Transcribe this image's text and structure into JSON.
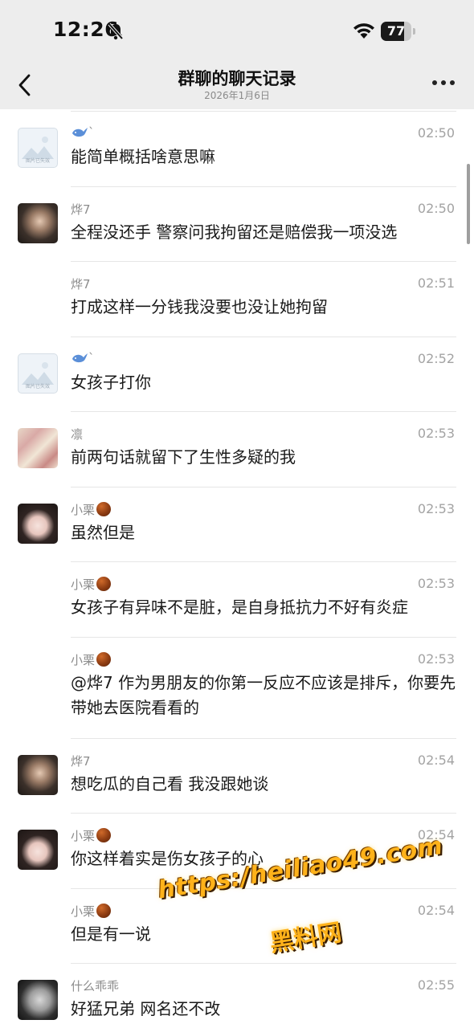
{
  "status": {
    "time": "12:26",
    "battery": "77",
    "battery_level": 0.77
  },
  "nav": {
    "title": "群聊的聊天记录",
    "subtitle": "2026年1月6日"
  },
  "colors": {
    "bar_bg": "#ededed",
    "watermark": "#ffb21a"
  },
  "messages": [
    {
      "sender": "",
      "sender_icon": "whale-icon",
      "sender_suffix": "`",
      "time": "02:50",
      "text": "能简单概括啥意思嘛",
      "avatar": "placeholder-image",
      "lines": 1
    },
    {
      "sender": "烨7",
      "time": "02:50",
      "text": "全程没还手 警察问我拘留还是赔偿我一项没选",
      "avatar": "dark-photo",
      "lines": 1
    },
    {
      "sender": "烨7",
      "time": "02:51",
      "text": "打成这样一分钱我没要也没让她拘留",
      "avatar": "",
      "lines": 1
    },
    {
      "sender": "",
      "sender_icon": "whale-icon",
      "sender_suffix": "`",
      "time": "02:52",
      "text": "女孩子打你",
      "avatar": "placeholder-image",
      "lines": 1
    },
    {
      "sender": "凛",
      "time": "02:53",
      "text": "前两句话就留下了生性多疑的我",
      "avatar": "money-photo",
      "lines": 1
    },
    {
      "sender": "小栗",
      "sender_icon": "chestnut-icon",
      "time": "02:53",
      "text": "虽然但是",
      "avatar": "girl-photo",
      "lines": 1
    },
    {
      "sender": "小栗",
      "sender_icon": "chestnut-icon",
      "time": "02:53",
      "text": "女孩子有异味不是脏，是自身抵抗力不好有炎症",
      "avatar": "",
      "lines": 1
    },
    {
      "sender": "小栗",
      "sender_icon": "chestnut-icon",
      "time": "02:53",
      "text": "@烨7 作为男朋友的你第一反应不应该是排斥，你要先带她去医院看看的",
      "avatar": "",
      "lines": 2
    },
    {
      "sender": "烨7",
      "time": "02:54",
      "text": "想吃瓜的自己看 我没跟她谈",
      "avatar": "dark-photo",
      "lines": 1
    },
    {
      "sender": "小栗",
      "sender_icon": "chestnut-icon",
      "time": "02:54",
      "text": "你这样着实是伤女孩子的心",
      "avatar": "girl-photo",
      "lines": 1
    },
    {
      "sender": "小栗",
      "sender_icon": "chestnut-icon",
      "time": "02:54",
      "text": "但是有一说",
      "avatar": "",
      "lines": 1
    },
    {
      "sender": "什么乖乖",
      "time": "02:55",
      "text": "好猛兄弟 网名还不改",
      "avatar": "dim-photo",
      "lines": 1
    }
  ],
  "placeholder_avatar_caption": "图片已失效",
  "watermark": {
    "url": "https:/heiliao49.com",
    "name": "黑料网"
  }
}
